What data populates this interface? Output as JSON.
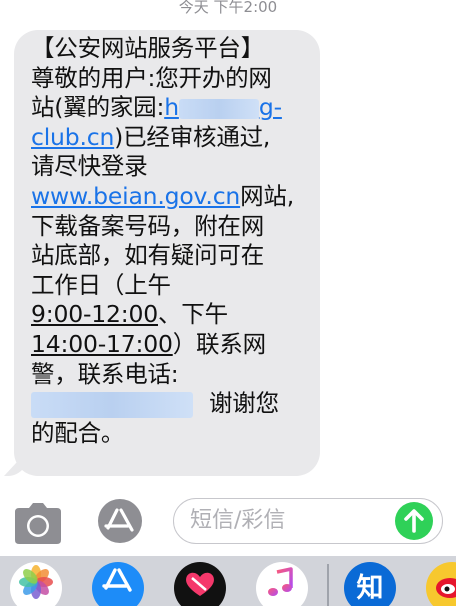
{
  "timestamp": "今天 下午2:00",
  "message": {
    "line1": "【公安网站服务平台】",
    "line2": "尊敬的用户:您开办的网",
    "line3_pre": "站(翼的家园:",
    "line3_link_start": "h",
    "line3_link_end": "g-",
    "line4_link": "club.cn",
    "line4_post": ")已经审核通过,",
    "line5": "请尽快登录",
    "line6_link": "www.beian.gov.cn",
    "line6_post": "网站,",
    "line7": "下载备案号码，附在网",
    "line8": "站底部，如有疑问可在",
    "line9": "工作日（上午",
    "line10_time": "9:00-12:00",
    "line10_post": "、下午",
    "line11_time": "14:00-17:00",
    "line11_post": "）联系网",
    "line12": "警，联系电话:",
    "line13_post": "谢谢您",
    "line14": "的配合。"
  },
  "composer": {
    "placeholder": "短信/彩信"
  },
  "apps": {
    "zhihu_label": "知"
  },
  "colors": {
    "bubble": "#e9e9eb",
    "link": "#1a73e8",
    "send": "#2fd158",
    "appstore": "#1d8cf8",
    "zhihu": "#0a6ad6",
    "tray": "#d2d4da"
  },
  "icons": [
    "camera-icon",
    "appstore-icon",
    "send-arrow-icon",
    "photos-icon",
    "heart-app-icon",
    "music-icon",
    "zhihu-icon",
    "weibo-icon"
  ]
}
